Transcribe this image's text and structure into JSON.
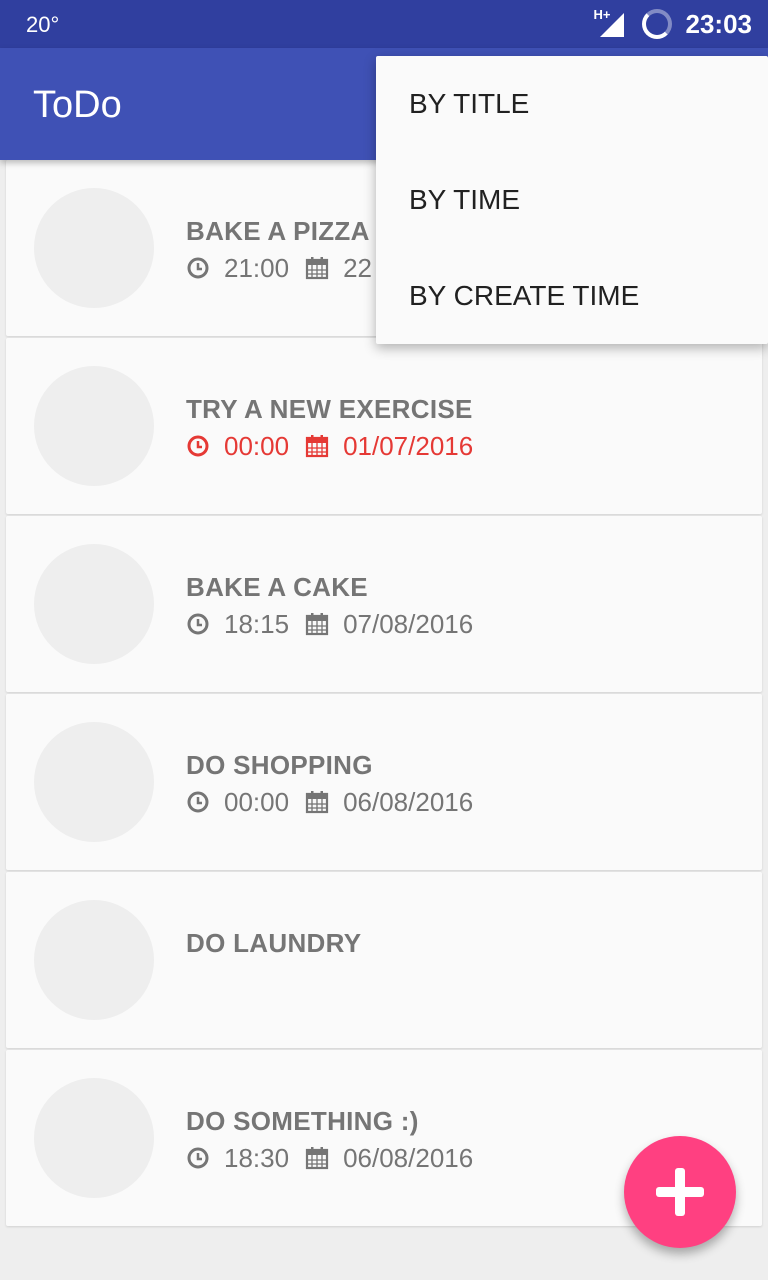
{
  "status_bar": {
    "temperature": "20°",
    "network": "H+",
    "time": "23:03"
  },
  "app_bar": {
    "title": "ToDo"
  },
  "sort_menu": {
    "items": [
      {
        "label": "BY TITLE"
      },
      {
        "label": "BY TIME"
      },
      {
        "label": "BY CREATE TIME"
      }
    ]
  },
  "tasks": [
    {
      "title": "BAKE A PIZZA",
      "time": "21:00",
      "date": "22",
      "overdue": false
    },
    {
      "title": "TRY A NEW EXERCISE",
      "time": "00:00",
      "date": "01/07/2016",
      "overdue": true
    },
    {
      "title": "BAKE A CAKE",
      "time": "18:15",
      "date": "07/08/2016",
      "overdue": false
    },
    {
      "title": "DO SHOPPING",
      "time": "00:00",
      "date": "06/08/2016",
      "overdue": false
    },
    {
      "title": "DO LAUNDRY",
      "time": "",
      "date": "",
      "overdue": false
    },
    {
      "title": "DO SOMETHING :)",
      "time": "18:30",
      "date": "06/08/2016",
      "overdue": false
    }
  ],
  "colors": {
    "primary": "#3f51b5",
    "primary_dark": "#303f9f",
    "accent": "#ff4081",
    "overdue": "#e53935",
    "text_secondary": "#757575"
  },
  "icons": {
    "time": "clock-icon",
    "date": "calendar-icon",
    "fab": "plus-icon"
  }
}
